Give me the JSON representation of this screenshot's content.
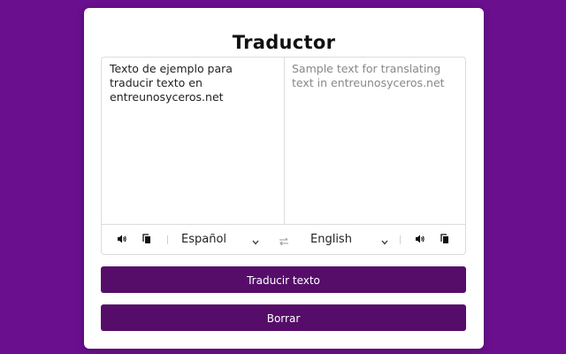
{
  "app": {
    "title": "Traductor"
  },
  "source": {
    "text": "Texto de ejemplo para traducir texto en entreunosyceros.net",
    "language": "Español"
  },
  "target": {
    "text": "Sample text for translating text in entreunosyceros.net",
    "language": "English"
  },
  "buttons": {
    "translate_label": "Traducir texto",
    "clear_label": "Borrar"
  },
  "icons": {
    "speaker": "speaker-icon",
    "copy": "copy-icon",
    "swap": "swap-icon",
    "chevron": "chevron-down-icon"
  },
  "colors": {
    "background": "#6a0f8e",
    "button": "#560d6a",
    "card": "#ffffff"
  }
}
